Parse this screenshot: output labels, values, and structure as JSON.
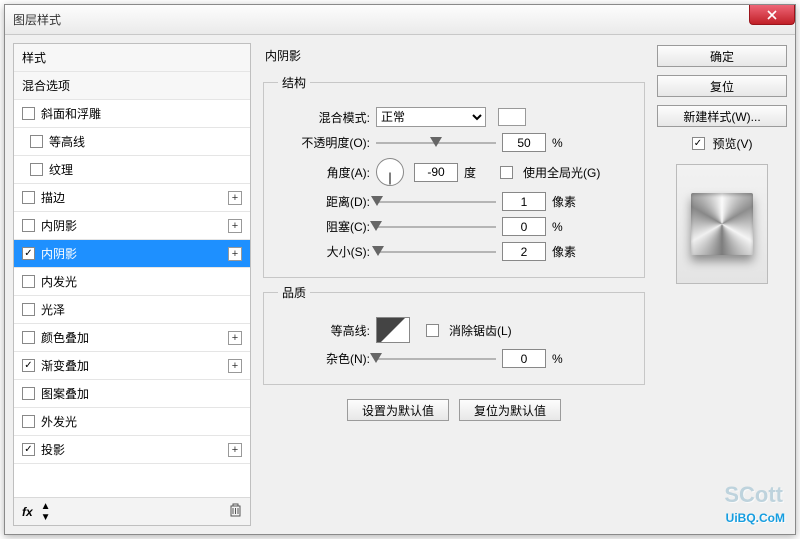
{
  "window": {
    "title": "图层样式"
  },
  "sidebar": {
    "header_styles": "样式",
    "header_blend": "混合选项",
    "items": [
      {
        "label": "斜面和浮雕",
        "checked": false,
        "plus": false,
        "indent": false
      },
      {
        "label": "等高线",
        "checked": false,
        "plus": false,
        "indent": true
      },
      {
        "label": "纹理",
        "checked": false,
        "plus": false,
        "indent": true
      },
      {
        "label": "描边",
        "checked": false,
        "plus": true,
        "indent": false
      },
      {
        "label": "内阴影",
        "checked": false,
        "plus": true,
        "indent": false
      },
      {
        "label": "内阴影",
        "checked": true,
        "plus": true,
        "indent": false,
        "selected": true
      },
      {
        "label": "内发光",
        "checked": false,
        "plus": false,
        "indent": false
      },
      {
        "label": "光泽",
        "checked": false,
        "plus": false,
        "indent": false
      },
      {
        "label": "颜色叠加",
        "checked": false,
        "plus": true,
        "indent": false
      },
      {
        "label": "渐变叠加",
        "checked": true,
        "plus": true,
        "indent": false
      },
      {
        "label": "图案叠加",
        "checked": false,
        "plus": false,
        "indent": false
      },
      {
        "label": "外发光",
        "checked": false,
        "plus": false,
        "indent": false
      },
      {
        "label": "投影",
        "checked": true,
        "plus": true,
        "indent": false
      }
    ],
    "footer_fx": "fx"
  },
  "main": {
    "title": "内阴影",
    "structure": {
      "legend": "结构",
      "blend_label": "混合模式:",
      "blend_value": "正常",
      "opacity_label": "不透明度(O):",
      "opacity_value": "50",
      "opacity_unit": "%",
      "angle_label": "角度(A):",
      "angle_value": "-90",
      "angle_unit": "度",
      "global_light_label": "使用全局光(G)",
      "distance_label": "距离(D):",
      "distance_value": "1",
      "distance_unit": "像素",
      "choke_label": "阻塞(C):",
      "choke_value": "0",
      "choke_unit": "%",
      "size_label": "大小(S):",
      "size_value": "2",
      "size_unit": "像素"
    },
    "quality": {
      "legend": "品质",
      "contour_label": "等高线:",
      "antialias_label": "消除锯齿(L)",
      "noise_label": "杂色(N):",
      "noise_value": "0",
      "noise_unit": "%"
    },
    "set_default": "设置为默认值",
    "reset_default": "复位为默认值"
  },
  "right": {
    "ok": "确定",
    "cancel": "复位",
    "new_style": "新建样式(W)...",
    "preview": "预览(V)"
  },
  "watermark": {
    "text": "UiBQ.CoM",
    "faint": "SCott"
  }
}
